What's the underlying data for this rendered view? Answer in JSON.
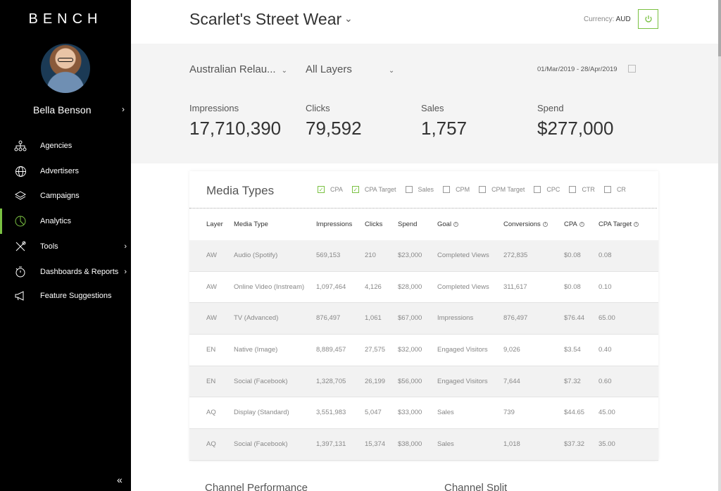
{
  "brand": "BENCH",
  "user": {
    "name": "Bella Benson"
  },
  "nav": [
    {
      "label": "Agencies",
      "icon": "hierarchy-icon"
    },
    {
      "label": "Advertisers",
      "icon": "globe-icon"
    },
    {
      "label": "Campaigns",
      "icon": "layers-icon"
    },
    {
      "label": "Analytics",
      "icon": "pie-chart-icon",
      "active": true
    },
    {
      "label": "Tools",
      "icon": "tools-icon",
      "submenu": true
    },
    {
      "label": "Dashboards & Reports",
      "icon": "stopwatch-icon",
      "submenu": true
    },
    {
      "label": "Feature Suggestions",
      "icon": "megaphone-icon"
    }
  ],
  "header": {
    "client": "Scarlet's Street Wear",
    "currency_label": "Currency:",
    "currency_value": "AUD"
  },
  "filters": {
    "campaign": "Australian Relau...",
    "layers": "All Layers",
    "date_range": "01/Mar/2019 - 28/Apr/2019"
  },
  "metrics": [
    {
      "label": "Impressions",
      "value": "17,710,390"
    },
    {
      "label": "Clicks",
      "value": "79,592"
    },
    {
      "label": "Sales",
      "value": "1,757"
    },
    {
      "label": "Spend",
      "value": "$277,000"
    }
  ],
  "media_types": {
    "title": "Media Types",
    "legend": [
      {
        "label": "CPA",
        "checked": true
      },
      {
        "label": "CPA Target",
        "checked": true
      },
      {
        "label": "Sales",
        "checked": false
      },
      {
        "label": "CPM",
        "checked": false
      },
      {
        "label": "CPM Target",
        "checked": false
      },
      {
        "label": "CPC",
        "checked": false
      },
      {
        "label": "CTR",
        "checked": false
      },
      {
        "label": "CR",
        "checked": false
      }
    ],
    "columns": [
      "Layer",
      "Media Type",
      "Impressions",
      "Clicks",
      "Spend",
      "Goal",
      "Conversions",
      "CPA",
      "CPA Target"
    ],
    "rows": [
      [
        "AW",
        "Audio (Spotify)",
        "569,153",
        "210",
        "$23,000",
        "Completed Views",
        "272,835",
        "$0.08",
        "0.08"
      ],
      [
        "AW",
        "Online Video (Instream)",
        "1,097,464",
        "4,126",
        "$28,000",
        "Completed Views",
        "311,617",
        "$0.08",
        "0.10"
      ],
      [
        "AW",
        "TV (Advanced)",
        "876,497",
        "1,061",
        "$67,000",
        "Impressions",
        "876,497",
        "$76.44",
        "65.00"
      ],
      [
        "EN",
        "Native (Image)",
        "8,889,457",
        "27,575",
        "$32,000",
        "Engaged Visitors",
        "9,026",
        "$3.54",
        "0.40"
      ],
      [
        "EN",
        "Social (Facebook)",
        "1,328,705",
        "26,199",
        "$56,000",
        "Engaged Visitors",
        "7,644",
        "$7.32",
        "0.60"
      ],
      [
        "AQ",
        "Display (Standard)",
        "3,551,983",
        "5,047",
        "$33,000",
        "Sales",
        "739",
        "$44.65",
        "45.00"
      ],
      [
        "AQ",
        "Social (Facebook)",
        "1,397,131",
        "15,374",
        "$38,000",
        "Sales",
        "1,018",
        "$37.32",
        "35.00"
      ]
    ]
  },
  "bottom_cards": [
    "Channel Performance",
    "Channel Split"
  ],
  "colors": {
    "accent": "#7ac142",
    "sidebar": "#000000"
  }
}
